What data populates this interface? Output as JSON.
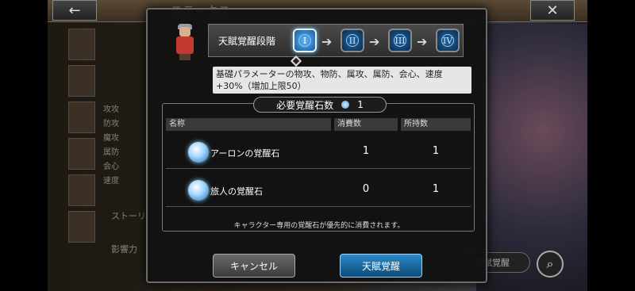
{
  "background": {
    "title": "ステータス",
    "back_icon": "←",
    "close_icon": "✕",
    "stats": [
      "攻攻",
      "防攻",
      "魔攻",
      "属防",
      "会心",
      "速度"
    ],
    "story_label": "ストーリ",
    "influence_label": "影響力",
    "awaken_button": "天賦覚醒",
    "search_icon": "⌕"
  },
  "dialog": {
    "stage_label": "天賦覚醒段階",
    "stages": [
      "I",
      "II",
      "III",
      "IV"
    ],
    "active_stage_index": 0,
    "arrow": "➔",
    "description": "基礎パラメーターの物攻、物防、属攻、属防、会心、速度+30%（増加上限50）",
    "required_label": "必要覚醒石数",
    "required_count": "1",
    "columns": {
      "name": "名称",
      "cost": "消費数",
      "owned": "所持数"
    },
    "items": [
      {
        "name": "アーロンの覚醒石",
        "cost": "1",
        "owned": "1"
      },
      {
        "name": "旅人の覚醒石",
        "cost": "0",
        "owned": "1"
      }
    ],
    "note": "キャラクター専用の覚醒石が優先的に消費されます。",
    "cancel_label": "キャンセル",
    "confirm_label": "天賦覚醒"
  },
  "colors": {
    "accent": "#2a8ac8",
    "dialog_bg": "#121212"
  }
}
